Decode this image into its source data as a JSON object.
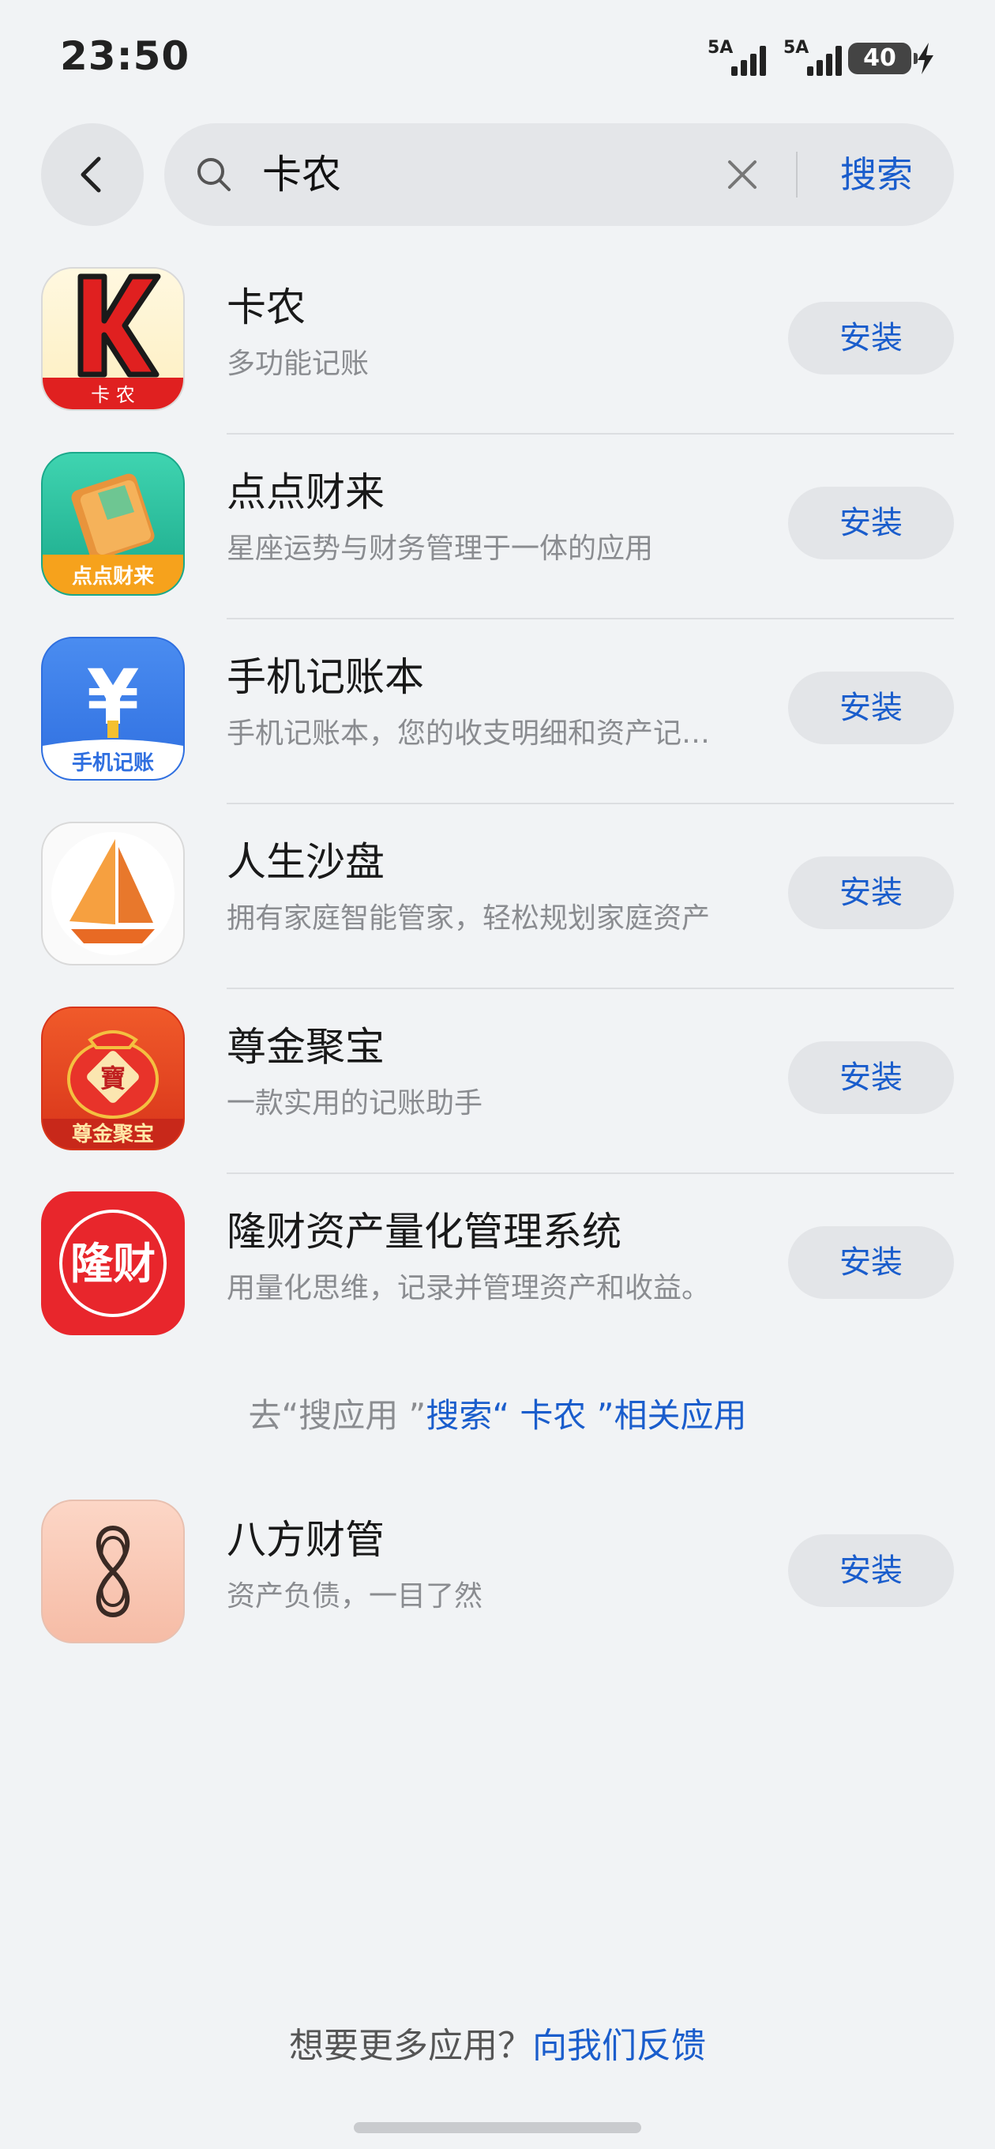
{
  "status": {
    "time": "23:50",
    "sim1": "5A",
    "sim2": "5A",
    "battery": "40"
  },
  "search": {
    "query": "卡农",
    "button": "搜索"
  },
  "apps": [
    {
      "name": "卡农",
      "desc": "多功能记账",
      "install": "安装",
      "icon_label": "卡 农",
      "icon_letter": "K"
    },
    {
      "name": "点点财来",
      "desc": "星座运势与财务管理于一体的应用",
      "install": "安装",
      "icon_label": "点点财来"
    },
    {
      "name": "手机记账本",
      "desc": "手机记账本，您的收支明细和资产记…",
      "install": "安装",
      "icon_label": "手机记账",
      "icon_symbol": "¥"
    },
    {
      "name": "人生沙盘",
      "desc": "拥有家庭智能管家，轻松规划家庭资产",
      "install": "安装"
    },
    {
      "name": "尊金聚宝",
      "desc": "一款实用的记账助手",
      "install": "安装",
      "icon_label": "尊金聚宝",
      "icon_symbol": "寶"
    },
    {
      "name": "隆财资产量化管理系统",
      "desc": "用量化思维，记录并管理资产和收益。",
      "install": "安装",
      "icon_label": "隆财"
    }
  ],
  "more_link": {
    "prefix": "去“搜应用 ”",
    "action": "搜索“ 卡农 ”相关应用"
  },
  "extra_app": {
    "name": "八方财管",
    "desc": "资产负债，一目了然",
    "install": "安装"
  },
  "feedback": {
    "prefix": "想要更多应用？",
    "action": "向我们反馈"
  }
}
